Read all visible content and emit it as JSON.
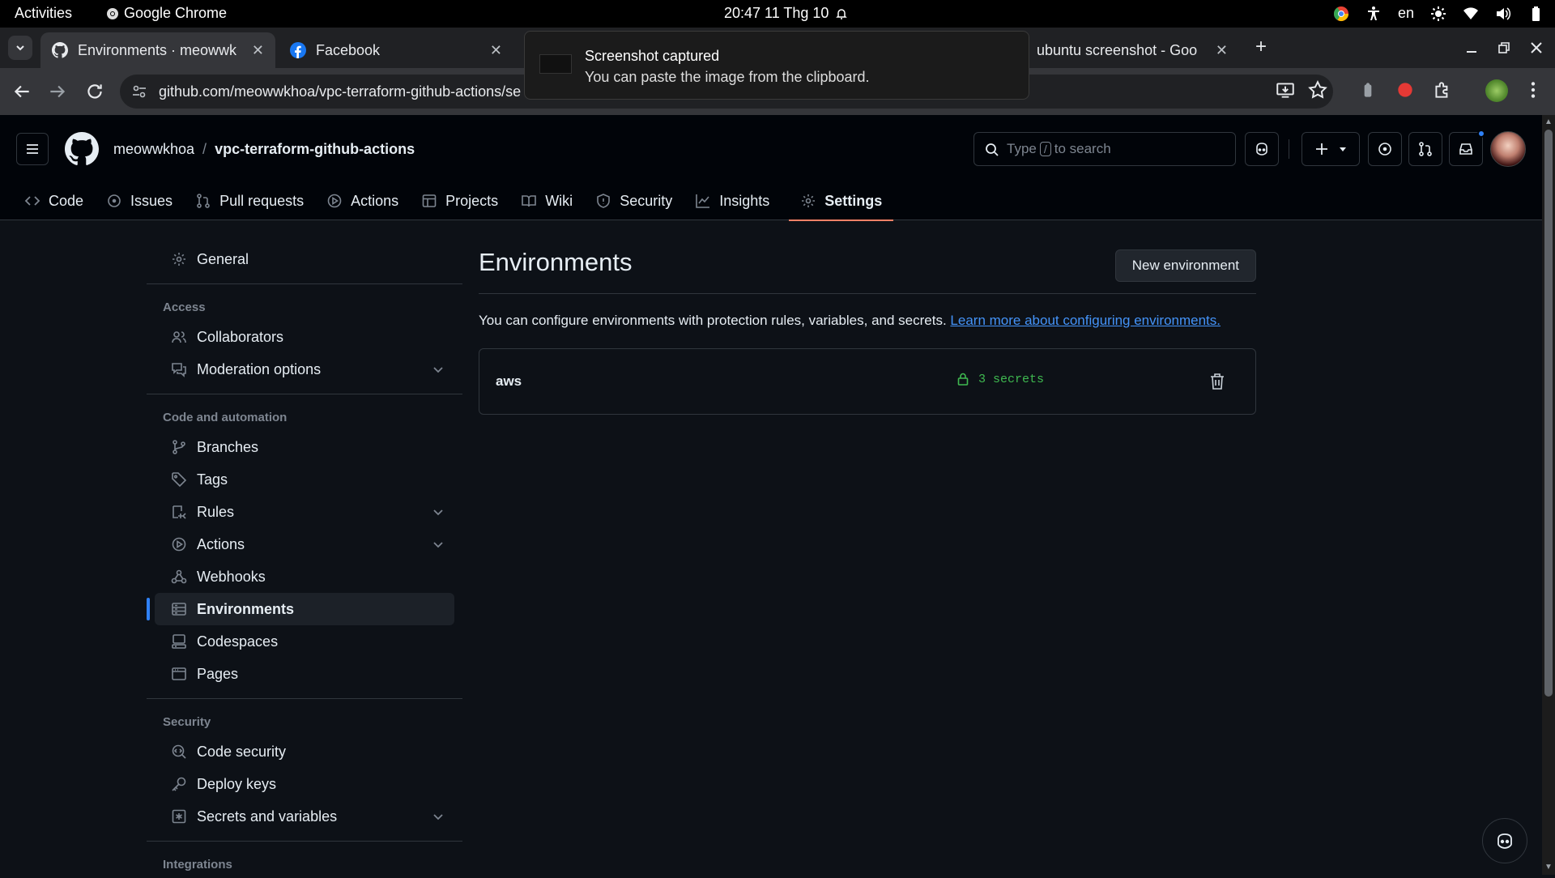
{
  "system_bar": {
    "activities": "Activities",
    "app_name": "Google Chrome",
    "clock": "20:47  11 Thg 10",
    "language": "en"
  },
  "browser": {
    "tabs": [
      {
        "title": "Environments · meowwk",
        "icon": "github-icon",
        "active": true
      },
      {
        "title": "Facebook",
        "icon": "facebook-icon",
        "active": false
      },
      {
        "title": "ubuntu screenshot - Goo",
        "icon": "google-icon",
        "active": false
      }
    ],
    "url": "github.com/meowwkhoa/vpc-terraform-github-actions/se"
  },
  "notification": {
    "title": "Screenshot captured",
    "body": "You can paste the image from the clipboard."
  },
  "github": {
    "owner": "meowwkhoa",
    "separator": "/",
    "repo": "vpc-terraform-github-actions",
    "search": {
      "prefix": "Type",
      "key": "/",
      "suffix": "to search"
    },
    "repo_nav": [
      {
        "label": "Code",
        "icon": "code-icon"
      },
      {
        "label": "Issues",
        "icon": "issue-icon"
      },
      {
        "label": "Pull requests",
        "icon": "pull-request-icon"
      },
      {
        "label": "Actions",
        "icon": "play-icon"
      },
      {
        "label": "Projects",
        "icon": "table-icon"
      },
      {
        "label": "Wiki",
        "icon": "book-icon"
      },
      {
        "label": "Security",
        "icon": "shield-icon"
      },
      {
        "label": "Insights",
        "icon": "graph-icon"
      },
      {
        "label": "Settings",
        "icon": "gear-icon",
        "selected": true
      }
    ]
  },
  "sidebar": {
    "general": "General",
    "access_heading": "Access",
    "access": [
      {
        "label": "Collaborators",
        "icon": "people-icon"
      },
      {
        "label": "Moderation options",
        "icon": "comment-discussion-icon",
        "expandable": true
      }
    ],
    "code_heading": "Code and automation",
    "code": [
      {
        "label": "Branches",
        "icon": "branch-icon"
      },
      {
        "label": "Tags",
        "icon": "tag-icon"
      },
      {
        "label": "Rules",
        "icon": "rules-icon",
        "expandable": true
      },
      {
        "label": "Actions",
        "icon": "play-icon",
        "expandable": true
      },
      {
        "label": "Webhooks",
        "icon": "webhook-icon"
      },
      {
        "label": "Environments",
        "icon": "server-icon",
        "active": true
      },
      {
        "label": "Codespaces",
        "icon": "codespaces-icon"
      },
      {
        "label": "Pages",
        "icon": "browser-icon"
      }
    ],
    "security_heading": "Security",
    "security": [
      {
        "label": "Code security",
        "icon": "codescan-icon"
      },
      {
        "label": "Deploy keys",
        "icon": "key-icon"
      },
      {
        "label": "Secrets and variables",
        "icon": "key-asterisk-icon",
        "expandable": true
      }
    ],
    "integrations_heading": "Integrations"
  },
  "main": {
    "title": "Environments",
    "new_button": "New environment",
    "description": "You can configure environments with protection rules, variables, and secrets.",
    "learn_more": "Learn more about configuring environments.",
    "environments": [
      {
        "name": "aws",
        "secrets": "3 secrets"
      }
    ]
  },
  "colors": {
    "accent_blue": "#2f81f7",
    "settings_underline": "#f78166",
    "secrets_green": "#3fb950",
    "background": "#0d1117"
  }
}
